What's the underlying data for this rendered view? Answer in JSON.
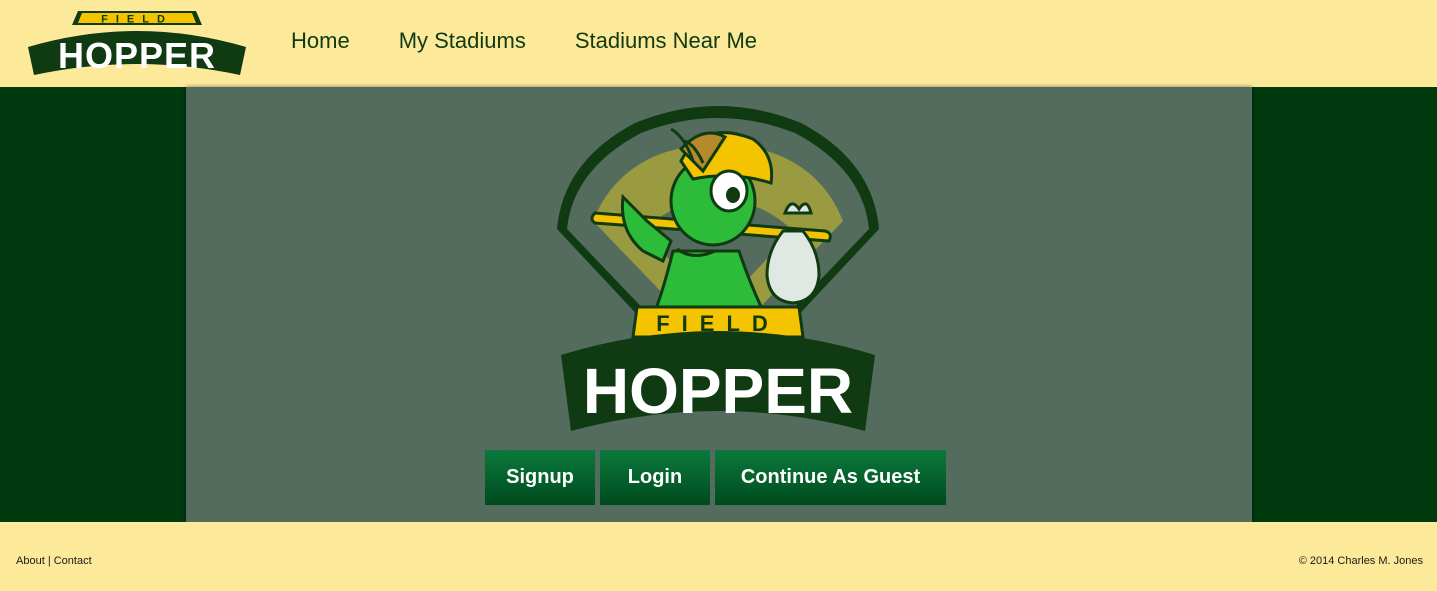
{
  "header": {
    "logo": {
      "top_text": "FIELD",
      "main_text": "HOPPER"
    },
    "nav": [
      {
        "label": "Home"
      },
      {
        "label": "My Stadiums"
      },
      {
        "label": "Stadiums Near Me"
      }
    ]
  },
  "hero": {
    "logo": {
      "top_text": "FIELD",
      "main_text": "HOPPER"
    },
    "buttons": {
      "signup": "Signup",
      "login": "Login",
      "guest": "Continue As Guest"
    }
  },
  "footer": {
    "about": "About",
    "separator": "|",
    "contact": "Contact",
    "copyright": "© 2014 Charles M. Jones"
  },
  "colors": {
    "cream": "#fde99a",
    "dark_green": "#003a0e",
    "panel_gray_green": "#546c5e",
    "button_green": "#0a7a3c",
    "bright_green": "#2dbb3a",
    "yellow": "#f4c400"
  }
}
